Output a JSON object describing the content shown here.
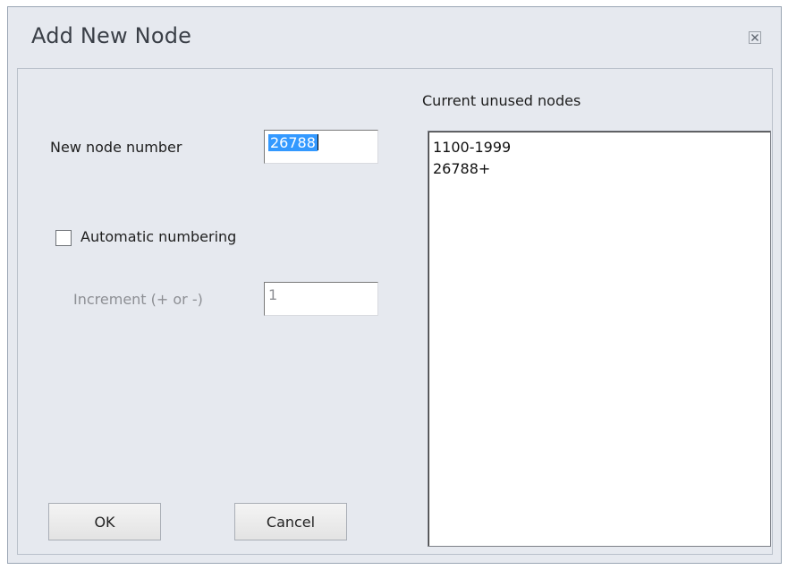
{
  "window": {
    "title": "Add New Node",
    "close_icon": "close-icon"
  },
  "form": {
    "new_node_label": "New node number",
    "new_node_value": "26788",
    "auto_numbering_label": "Automatic numbering",
    "auto_numbering_checked": false,
    "increment_label": "Increment (+ or -)",
    "increment_value": "1"
  },
  "unused": {
    "label": "Current unused nodes",
    "items": [
      "1100-1999",
      "26788+"
    ]
  },
  "buttons": {
    "ok_label": "OK",
    "cancel_label": "Cancel"
  }
}
